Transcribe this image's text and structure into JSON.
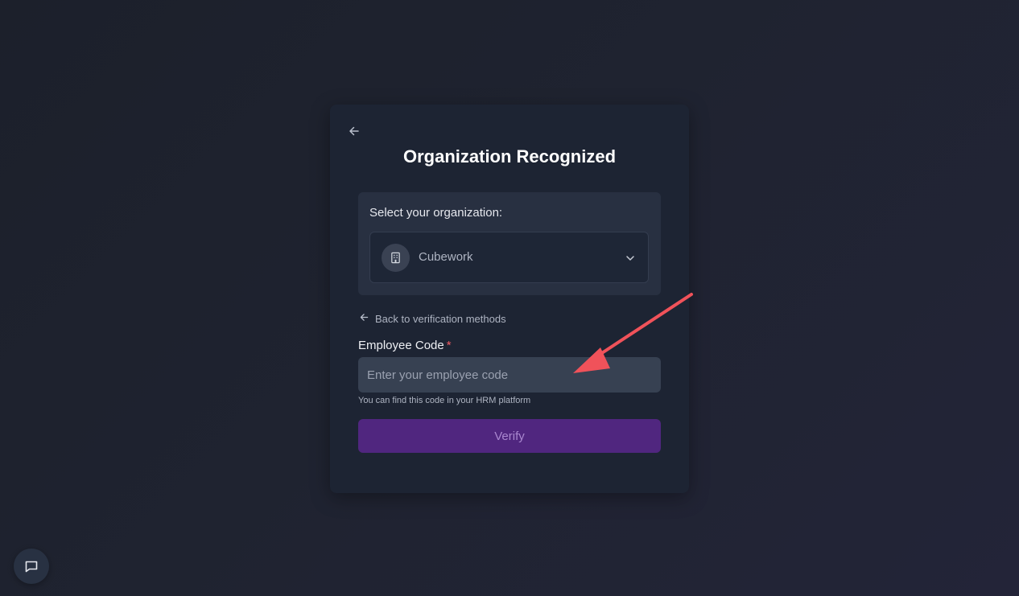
{
  "card": {
    "title": "Organization Recognized"
  },
  "organization": {
    "label": "Select your organization:",
    "selected": "Cubework"
  },
  "back_link": "Back to verification methods",
  "employee_code": {
    "label": "Employee Code",
    "required_marker": "*",
    "placeholder": "Enter your employee code",
    "hint": "You can find this code in your HRM platform"
  },
  "verify_button": "Verify",
  "colors": {
    "accent": "#50267f",
    "required": "#ef5b63",
    "annotation_arrow": "#f0525a"
  },
  "icons": {
    "back": "arrow-left-icon",
    "organization": "building-icon",
    "dropdown": "chevron-down-icon",
    "chat": "chat-bubble-icon"
  }
}
